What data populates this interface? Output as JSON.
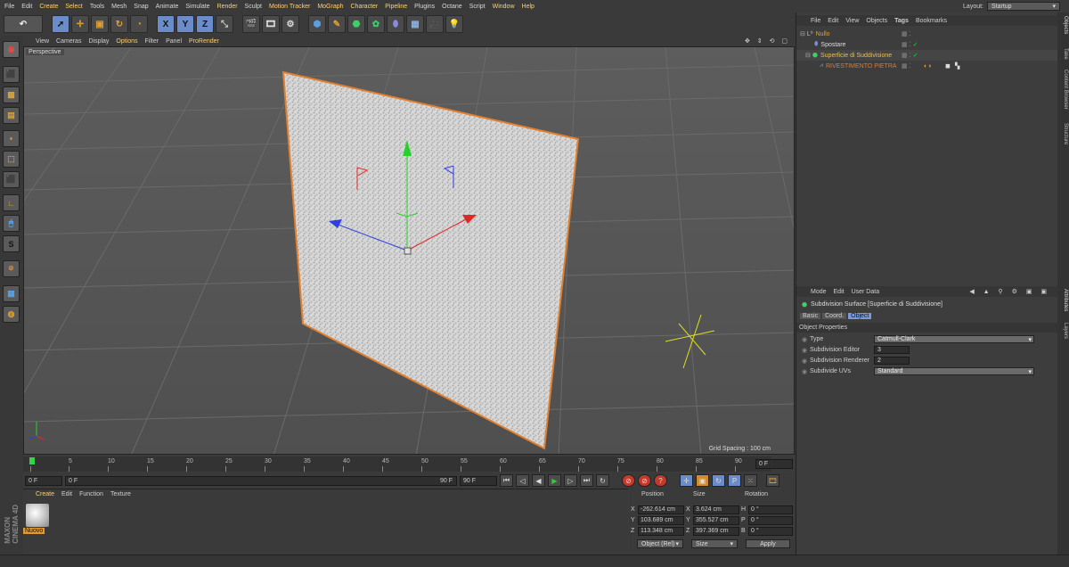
{
  "menu": [
    "File",
    "Edit",
    "Create",
    "Select",
    "Tools",
    "Mesh",
    "Snap",
    "Animate",
    "Simulate",
    "Render",
    "Sculpt",
    "Motion Tracker",
    "MoGraph",
    "Character",
    "Pipeline",
    "Plugins",
    "Octane",
    "Script",
    "Window",
    "Help"
  ],
  "layout": {
    "label": "Layout:",
    "value": "Startup"
  },
  "toolbar_letters": {
    "x": "X",
    "y": "Y",
    "z": "Z"
  },
  "viewport": {
    "menu": [
      "View",
      "Cameras",
      "Display",
      "Options",
      "Filter",
      "Panel",
      "ProRender"
    ],
    "label": "Perspective",
    "grid_spacing": "Grid Spacing : 100 cm"
  },
  "timeline": {
    "ticks": [
      "0",
      "5",
      "10",
      "15",
      "20",
      "25",
      "30",
      "35",
      "40",
      "45",
      "50",
      "55",
      "60",
      "65",
      "70",
      "75",
      "80",
      "85",
      "90"
    ],
    "end_field": "0 F",
    "start_field": "0 F",
    "scrub_start": "0 F",
    "scrub_end": "90 F",
    "max_field": "90 F"
  },
  "materials": {
    "menu": [
      "Create",
      "Edit",
      "Function",
      "Texture"
    ],
    "items": [
      {
        "name": "Nuovo"
      }
    ]
  },
  "coordinates": {
    "headers": {
      "position": "Position",
      "size": "Size",
      "rotation": "Rotation"
    },
    "rows": [
      {
        "axis": "X",
        "pos": "-262.614 cm",
        "size_axis": "X",
        "size": "3.624 cm",
        "rot_axis": "H",
        "rot": "0 °"
      },
      {
        "axis": "Y",
        "pos": "103.689 cm",
        "size_axis": "Y",
        "size": "355.527 cm",
        "rot_axis": "P",
        "rot": "0 °"
      },
      {
        "axis": "Z",
        "pos": "113.348 cm",
        "size_axis": "Z",
        "size": "397.369 cm",
        "rot_axis": "B",
        "rot": "0 °"
      }
    ],
    "mode_select": "Object (Rel)",
    "size_select": "Size",
    "apply_label": "Apply"
  },
  "objects": {
    "menu": [
      "File",
      "Edit",
      "View",
      "Objects",
      "Tags",
      "Bookmarks"
    ],
    "rows": [
      {
        "name": "Nullo",
        "indent": 0
      },
      {
        "name": "Spostare",
        "indent": 1
      },
      {
        "name": "Superficie di Suddivisione",
        "indent": 1
      },
      {
        "name": "RIVESTIMENTO PIETRA",
        "indent": 2
      }
    ]
  },
  "attributes": {
    "menu": [
      "Mode",
      "Edit",
      "User Data"
    ],
    "title": "Subdivision Surface [Superficie di Suddivisione]",
    "tabs": [
      "Basic",
      "Coord.",
      "Object"
    ],
    "section": "Object Properties",
    "props": [
      {
        "label": "Type",
        "value": "Catmull-Clark",
        "kind": "drop"
      },
      {
        "label": "Subdivision Editor",
        "value": "3",
        "kind": "num"
      },
      {
        "label": "Subdivision Renderer",
        "value": "2",
        "kind": "num"
      },
      {
        "label": "Subdivide UVs",
        "value": "Standard",
        "kind": "drop"
      }
    ]
  },
  "right_tabs": [
    "Objects",
    "Take",
    "Content Browser",
    "Structure",
    "Attributes",
    "Layers"
  ],
  "logo": {
    "line1": "MAXON",
    "line2": "CINEMA 4D"
  },
  "colors": {
    "accent": "#ffd070",
    "selection": "#e09830",
    "plane_outline": "#e08030"
  }
}
